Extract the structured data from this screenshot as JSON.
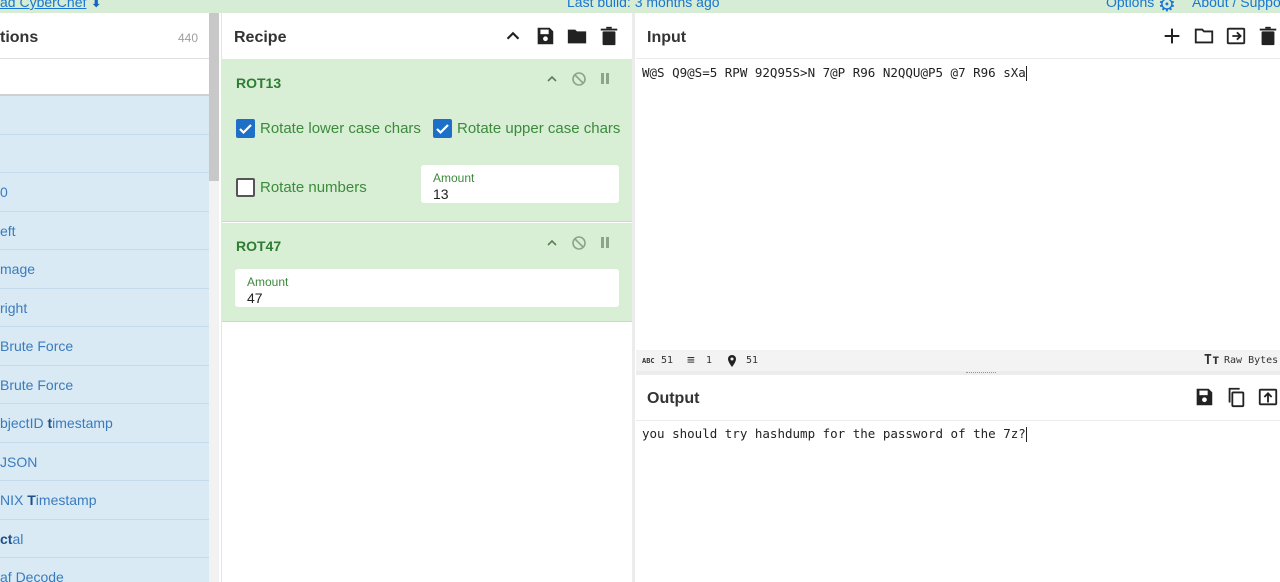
{
  "topbar": {
    "download_text": "ad CyberChef",
    "last_build": "Last build: 3 months ago",
    "options": "Options",
    "about": "About / Suppo"
  },
  "operations": {
    "title": "tions",
    "count": "440",
    "items": [
      {
        "pre": "",
        "bold": "",
        "post": ""
      },
      {
        "pre": "",
        "bold": "",
        "post": ""
      },
      {
        "pre": "0",
        "bold": "",
        "post": ""
      },
      {
        "pre": "eft",
        "bold": "",
        "post": ""
      },
      {
        "pre": "mage",
        "bold": "",
        "post": ""
      },
      {
        "pre": "right",
        "bold": "",
        "post": ""
      },
      {
        "pre": "Brute Force",
        "bold": "",
        "post": ""
      },
      {
        "pre": "Brute Force",
        "bold": "",
        "post": ""
      },
      {
        "pre": "bjectID ",
        "bold": "t",
        "post": "imestamp"
      },
      {
        "pre": "JSON",
        "bold": "",
        "post": ""
      },
      {
        "pre": "NIX ",
        "bold": "T",
        "post": "imestamp"
      },
      {
        "pre": "",
        "bold": "ct",
        "post": "al"
      },
      {
        "pre": "af Decode",
        "bold": "",
        "post": ""
      }
    ]
  },
  "recipe": {
    "title": "Recipe",
    "rot13": {
      "name": "ROT13",
      "lower_label": "Rotate lower case chars",
      "lower_checked": true,
      "upper_label": "Rotate upper case chars",
      "upper_checked": true,
      "numbers_label": "Rotate numbers",
      "numbers_checked": false,
      "amount_label": "Amount",
      "amount_value": "13"
    },
    "rot47": {
      "name": "ROT47",
      "amount_label": "Amount",
      "amount_value": "47"
    }
  },
  "input": {
    "title": "Input",
    "text": "W@S Q9@S=5 RPW 92Q95S>N 7@P R96 N2QQU@P5 @7 R96 sXa",
    "stats": {
      "chars": "51",
      "lines": "1",
      "position": "51"
    },
    "encoding": "Raw Bytes"
  },
  "output": {
    "title": "Output",
    "text": "you should try hashdump for the password of the 7z?"
  },
  "colors": {
    "accent_blue": "#1e6fc7",
    "op_green": "#d8eed5",
    "ops_blue": "#d9eaf4"
  }
}
